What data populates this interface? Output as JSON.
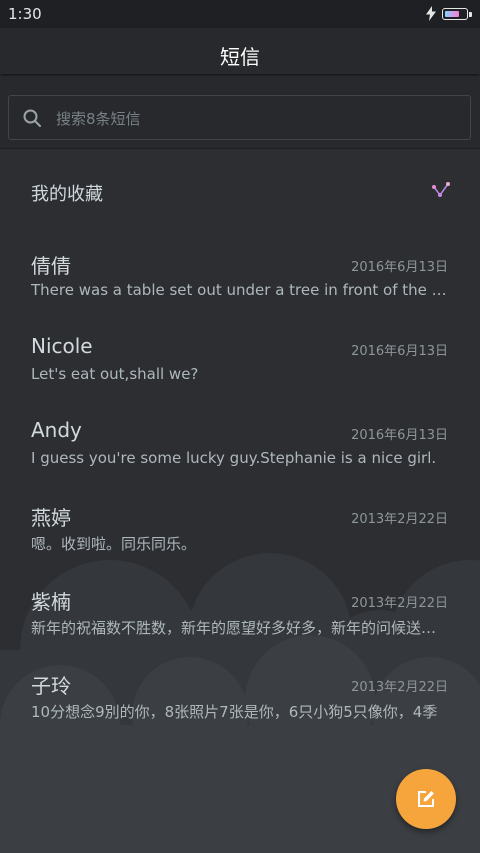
{
  "status": {
    "time": "1:30",
    "icons": [
      "charging-icon",
      "battery-icon"
    ]
  },
  "header": {
    "title": "短信"
  },
  "search": {
    "placeholder": "搜索8条短信",
    "icon": "search-icon"
  },
  "favorites": {
    "label": "我的收藏",
    "icon": "chart-icon"
  },
  "messages": [
    {
      "name": "倩倩",
      "date": "2016年6月13日",
      "preview": "There was a table set out under a tree in front of the house"
    },
    {
      "name": "Nicole",
      "date": "2016年6月13日",
      "preview": "Let's eat out,shall we?"
    },
    {
      "name": "Andy",
      "date": "2016年6月13日",
      "preview": "I guess you're some lucky guy.Stephanie is a nice girl."
    },
    {
      "name": "燕婷",
      "date": "2013年2月22日",
      "preview": "嗯。收到啦。同乐同乐。"
    },
    {
      "name": "紫楠",
      "date": "2013年2月22日",
      "preview": "新年的祝福数不胜数，新年的愿望好多好多，新年的问候送给你"
    },
    {
      "name": "子玲",
      "date": "2013年2月22日",
      "preview": "10分想念9別的你，8张照片7张是你，6只小狗5只像你，4季"
    }
  ],
  "fab": {
    "icon": "compose-icon"
  },
  "colors": {
    "accent": "#f5a53b",
    "background": "#2c2e32",
    "cloud": "#3b3e42"
  }
}
